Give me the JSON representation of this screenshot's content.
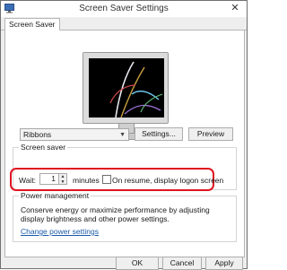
{
  "window": {
    "title": "Screen Saver Settings",
    "close_glyph": "✕"
  },
  "tabs": [
    {
      "label": "Screen Saver",
      "active": true
    }
  ],
  "screen_saver": {
    "group_label": "Screen saver",
    "selected": "Ribbons",
    "settings_label": "Settings...",
    "preview_label": "Preview"
  },
  "wait": {
    "label": "Wait:",
    "value": "1",
    "unit": "minutes",
    "resume_label": "On resume, display logon screen",
    "resume_checked": false
  },
  "power": {
    "group_label": "Power management",
    "description": "Conserve energy or maximize performance by adjusting display brightness and other power settings.",
    "link": "Change power settings"
  },
  "footer": {
    "ok": "OK",
    "cancel": "Cancel",
    "apply": "Apply"
  },
  "colors": {
    "highlight": "#e0141e",
    "link": "#1a5aa8"
  }
}
